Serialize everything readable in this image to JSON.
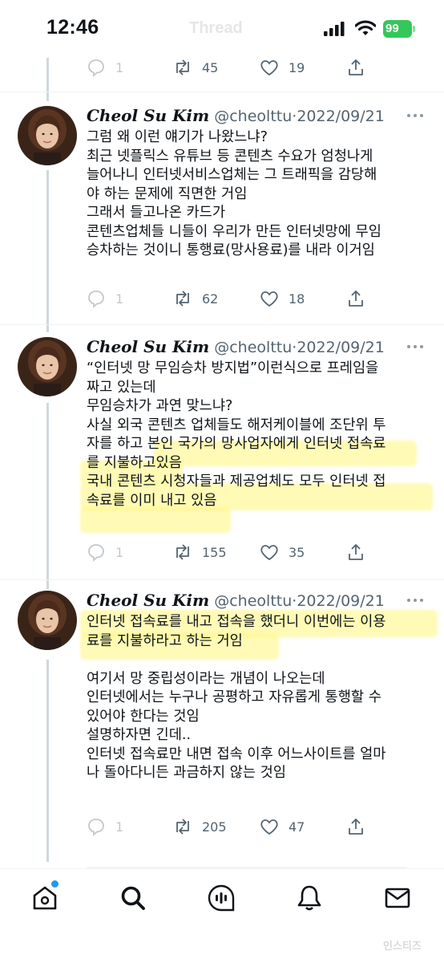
{
  "status_bar": {
    "time": "12:46",
    "ghost_title": "Thread",
    "battery": "99",
    "battery_color": "#34c759"
  },
  "top_actions": {
    "reply": "1",
    "retweet": "45",
    "like": "19"
  },
  "tweets": [
    {
      "name": "Cheol Su Kim",
      "handle": "@cheolttu",
      "sep": "·",
      "date": "2022/09/21",
      "lines": [
        "그럼 왜 이런 얘기가 나왔느냐?",
        "최근 넷플릭스 유튜브 등 콘텐츠 수요가 엄청나게",
        "늘어나니 인터넷서비스업체는 그 트래픽을 감당해",
        "야 하는 문제에 직면한 거임",
        "그래서 들고나온 카드가",
        "콘텐츠업체들 니들이 우리가 만든 인터넷망에 무임",
        "승차하는 것이니 통행료(망사용료)를 내라 이거임"
      ],
      "reply": "1",
      "retweet": "62",
      "like": "18"
    },
    {
      "name": "Cheol Su Kim",
      "handle": "@cheolttu",
      "sep": "·",
      "date": "2022/09/21",
      "lines": [
        "“인터넷 망 무임승차 방지법”이런식으로 프레임을",
        "짜고 있는데",
        "무임승차가 과연 맞느냐?",
        "사실 외국 콘텐츠 업체들도 해저케이블에 조단위 투",
        "자를 하고 본인 국가의 망사업자에게 인터넷 접속료",
        "를 지불하고있음",
        "국내 콘텐츠 시청자들과 제공업체도 모두 인터넷 접",
        "속료를 이미 내고 있음"
      ],
      "reply": "1",
      "retweet": "155",
      "like": "35"
    },
    {
      "name": "Cheol Su Kim",
      "handle": "@cheolttu",
      "sep": "·",
      "date": "2022/09/21",
      "lines": [
        "인터넷 접속료를 내고 접속을 했더니 이번에는 이용",
        "료를 지불하라고 하는 거임",
        "",
        "여기서 망 중립성이라는 개념이 나오는데",
        "인터넷에서는 누구나 공평하고 자유롭게 통행할 수",
        "있어야 한다는 것임",
        "설명하자면 긴데..",
        "인터넷 접속료만 내면 접속 이후 어느사이트를 얼마",
        "나 돌아다니든 과금하지 않는 것임"
      ],
      "reply": "1",
      "retweet": "205",
      "like": "47"
    }
  ],
  "bottom_nav": [
    {
      "icon": "home-icon"
    },
    {
      "icon": "search-icon"
    },
    {
      "icon": "spaces-icon"
    },
    {
      "icon": "notifications-icon"
    },
    {
      "icon": "messages-icon"
    }
  ],
  "watermark": "인스티즈",
  "colors": {
    "accent": "#1d9bf0",
    "muted": "#536471",
    "highlight": "#fff678"
  }
}
